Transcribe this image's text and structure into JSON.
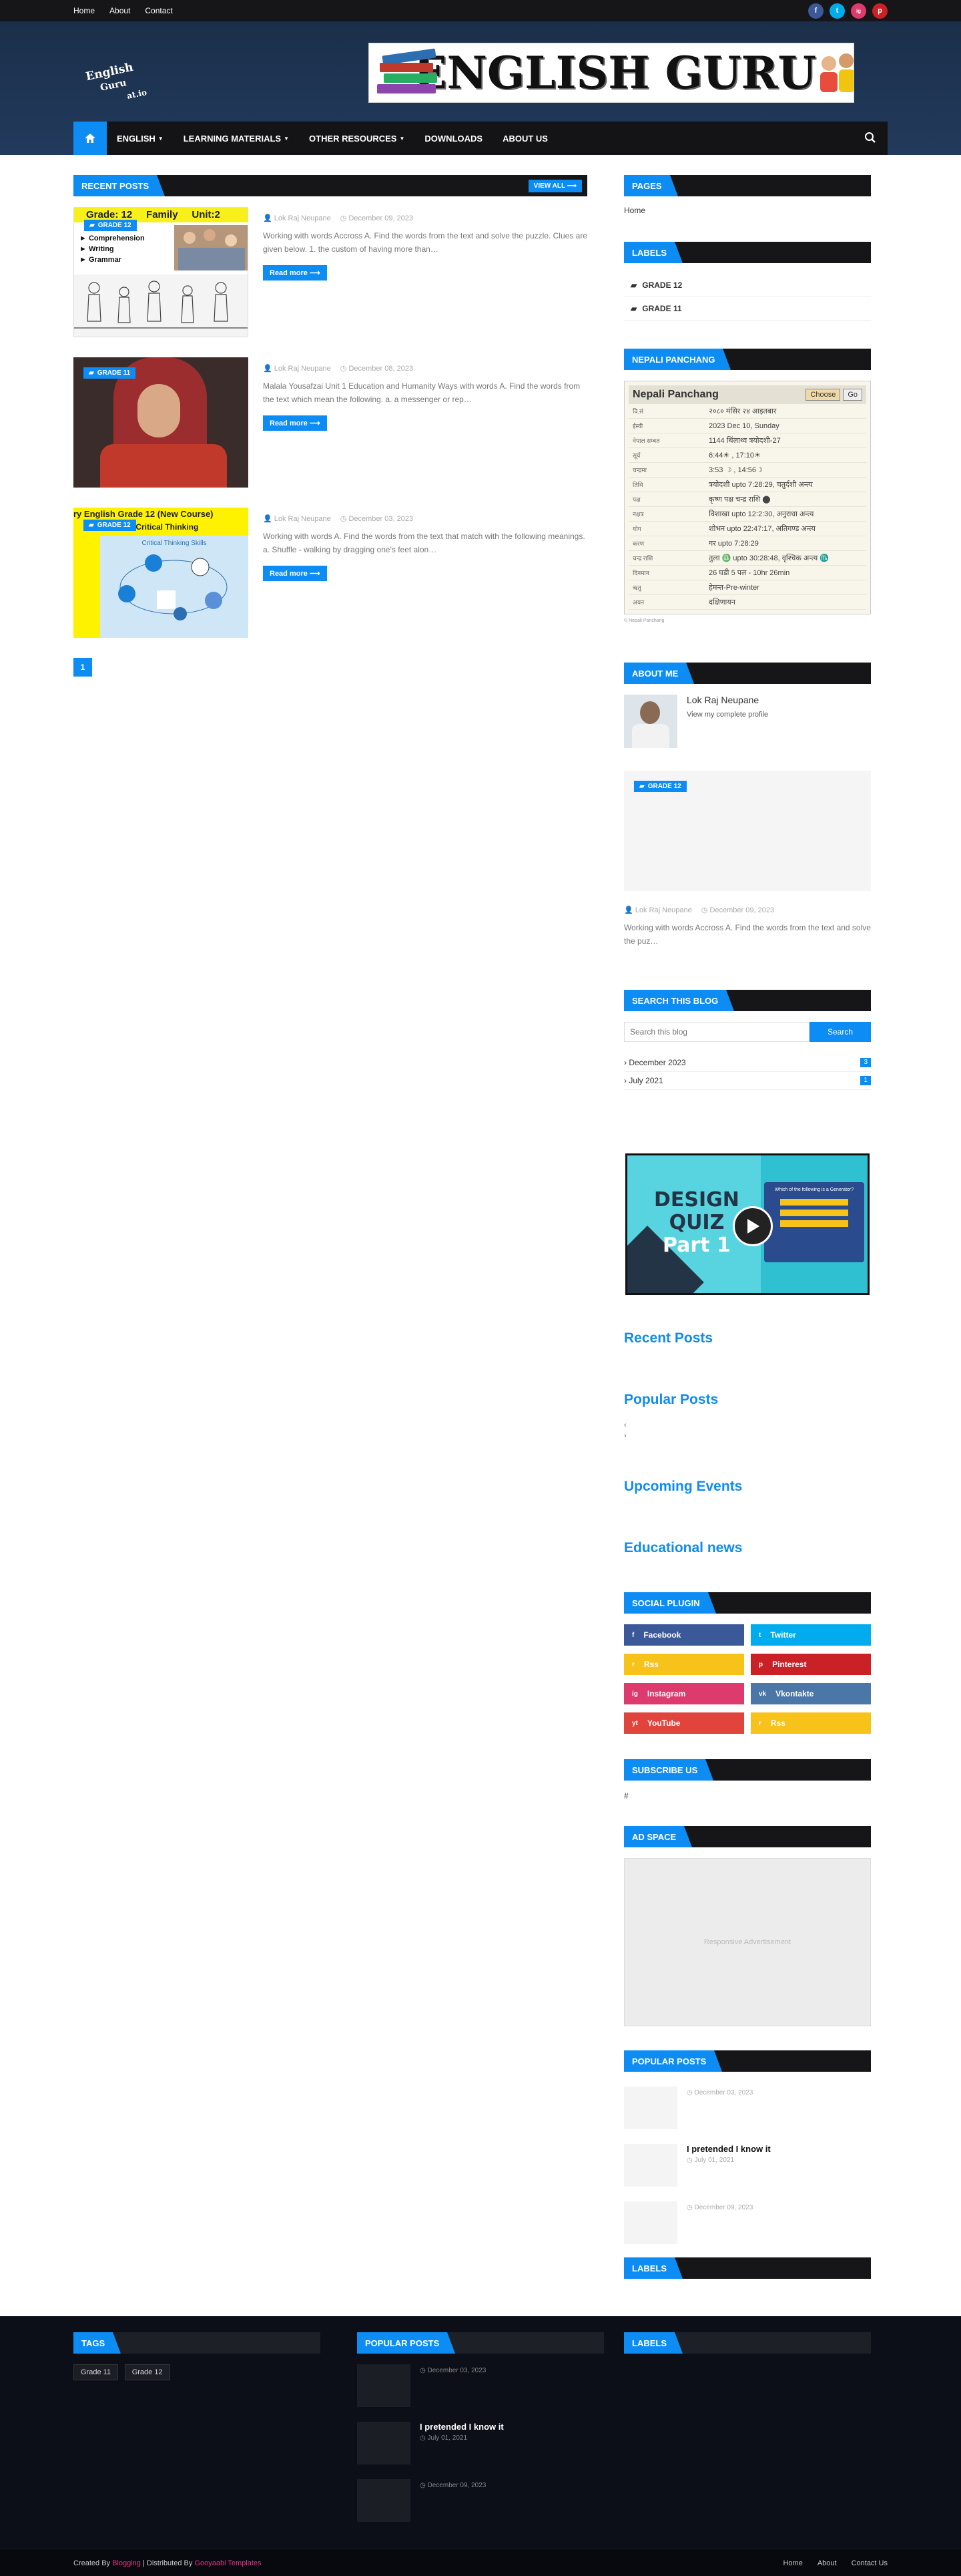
{
  "topbar": {
    "links": [
      "Home",
      "About",
      "Contact"
    ],
    "social": [
      "f",
      "t",
      "ig",
      "p"
    ]
  },
  "header": {
    "logo_l1": "English",
    "logo_l2": "Guru",
    "logo_l3": "at.io",
    "banner_title": "ENGLISH GURU"
  },
  "nav": {
    "items": [
      "ENGLISH",
      "LEARNING MATERIALS",
      "OTHER RESOURCES",
      "DOWNLOADS",
      "ABOUT US"
    ],
    "dropdowns": [
      true,
      true,
      true,
      false,
      false
    ]
  },
  "recent": {
    "title": "RECENT POSTS",
    "view_all": "VIEW ALL ⟶"
  },
  "posts": [
    {
      "badge": "GRADE 12",
      "author": "Lok Raj Neupane",
      "date": "December 09, 2023",
      "snippet": "Working with words Accross A.      Find the words from the text and solve the puzzle. Clues are given below. 1. the custom of having more than…",
      "read_more": "Read more ⟶",
      "img_title": "Grade: 12     Family     Unit:2",
      "img_items": [
        "Comprehension",
        "Writing",
        "Grammar"
      ]
    },
    {
      "badge": "GRADE 11",
      "author": "Lok Raj Neupane",
      "date": "December 08, 2023",
      "snippet": "Malala Yousafzai Unit 1 Education and Humanity      Ways with words A. Find the words from the text which mean the following. a. a messenger or rep…",
      "read_more": "Read more ⟶"
    },
    {
      "badge": "GRADE 12",
      "author": "Lok Raj Neupane",
      "date": "December 03, 2023",
      "snippet": "Working with words A. Find the words from the text that match with the following meanings. a. Shuffle - walking by dragging one's feet alon…",
      "read_more": "Read more ⟶",
      "img_title": "ry English Grade 12 (New Course)",
      "img_unit": "Unit: One  Critical Thinking",
      "img_skills": "Critical Thinking Skills"
    }
  ],
  "pager": "1",
  "sidebar": {
    "pages_title": "PAGES",
    "pages": [
      "Home"
    ],
    "labels_title": "LABELS",
    "labels": [
      "GRADE 12",
      "GRADE 11"
    ],
    "panchang_title": "NEPALI PANCHANG",
    "panchang": {
      "heading": "Nepali Panchang",
      "choose": "Choose",
      "go": "Go",
      "footer": "© Nepali Panchang",
      "rows": [
        {
          "k": "वि.सं",
          "v": "२०८० मंसिर २४ आइतबार"
        },
        {
          "k": "ईस्वी",
          "v": "2023 Dec 10, Sunday"
        },
        {
          "k": "नेपाल सम्बत",
          "v": "1144 थिंलाथ्व त्रयोदशी-27"
        },
        {
          "k": "सूर्य",
          "v": "6:44☀ , 17:10☀"
        },
        {
          "k": "चन्द्रमा",
          "v": "3:53 ☽ , 14:56☽"
        },
        {
          "k": "तिथि",
          "v": "त्रयोदशी upto 7:28:29, चतुर्दशी अन्त्य"
        },
        {
          "k": "पक्ष",
          "v": "कृष्ण पक्ष चन्द्र राशि ⬤"
        },
        {
          "k": "नक्षत्र",
          "v": "विशाखा upto 12:2:30, अनुराधा अन्त्य"
        },
        {
          "k": "योग",
          "v": "शोभन upto 22:47:17, अतिगण्ड अन्त्य"
        },
        {
          "k": "करण",
          "v": "गर upto 7:28:29"
        },
        {
          "k": "चन्द्र राशि",
          "v": "तुला ♎ upto 30:28:48, वृश्चिक अन्त्य ♏"
        },
        {
          "k": "दिनमान",
          "v": "26 घडी 5 पल - 10hr 26min"
        },
        {
          "k": "ऋतु",
          "v": "हेमन्त-Pre-winter"
        },
        {
          "k": "अयन",
          "v": "दक्षिणायन"
        }
      ]
    },
    "about_title": "ABOUT ME",
    "about_name": "Lok Raj Neupane",
    "about_profile": "View my complete profile",
    "featured": {
      "badge": "GRADE 12",
      "author": "Lok Raj Neupane",
      "date": "December 09, 2023",
      "snippet": "Working with words Accross A.    Find the words from the text and solve the puz…"
    },
    "search_title": "SEARCH THIS BLOG",
    "search_placeholder": "Search this blog",
    "search_button": "Search",
    "archive": [
      {
        "label": "December 2023",
        "count": "3"
      },
      {
        "label": "July 2021",
        "count": "1"
      }
    ],
    "video": {
      "l1": "DESIGN",
      "l2": "QUIZ",
      "l3": "Part 1",
      "question": "Which of the following is a Generator?"
    },
    "recent_posts": "Recent Posts",
    "popular_posts": "Popular Posts",
    "upcoming_events": "Upcoming Events",
    "educational_news": "Educational news",
    "popular_arrows": [
      "‹",
      "›"
    ],
    "social_title": "SOCIAL PLUGIN",
    "social": [
      {
        "label": "Facebook",
        "icon": "f",
        "color": "#3b5999"
      },
      {
        "label": "Twitter",
        "icon": "t",
        "color": "#00acee"
      },
      {
        "label": "Rss",
        "icon": "r",
        "color": "#f7c31a"
      },
      {
        "label": "Pinterest",
        "icon": "p",
        "color": "#ca2127"
      },
      {
        "label": "Instagram",
        "icon": "ig",
        "color": "#dd3a6e"
      },
      {
        "label": "Vkontakte",
        "icon": "vk",
        "color": "#4a76a8"
      },
      {
        "label": "YouTube",
        "icon": "yt",
        "color": "#e0443c"
      },
      {
        "label": "Rss",
        "icon": "r",
        "color": "#f7c31a"
      }
    ],
    "subscribe_title": "SUBSCRIBE US",
    "subscribe_text": "#",
    "ad_title": "AD SPACE",
    "ad_text": "Responsive Advertisement",
    "popular_title": "POPULAR POSTS",
    "popular": [
      {
        "title": "",
        "date": "December 03, 2023"
      },
      {
        "title": "I pretended I know it",
        "date": "July 01, 2021"
      },
      {
        "title": "",
        "date": "December 09, 2023"
      }
    ],
    "labels2_title": "LABELS"
  },
  "footer": {
    "tags_title": "TAGS",
    "tags": [
      "Grade 11",
      "Grade 12"
    ],
    "popular_title": "POPULAR POSTS",
    "popular": [
      {
        "title": "",
        "date": "December 03, 2023"
      },
      {
        "title": "I pretended I know it",
        "date": "July 01, 2021"
      },
      {
        "title": "",
        "date": "December 09, 2023"
      }
    ],
    "labels_title": "LABELS",
    "created_prefix": "Created By ",
    "created_by": "Blogging",
    "distributed_prefix": " | Distributed By ",
    "distributed_by": "Gooyaabi Templates",
    "links": [
      "Home",
      "About",
      "Contact Us"
    ]
  }
}
